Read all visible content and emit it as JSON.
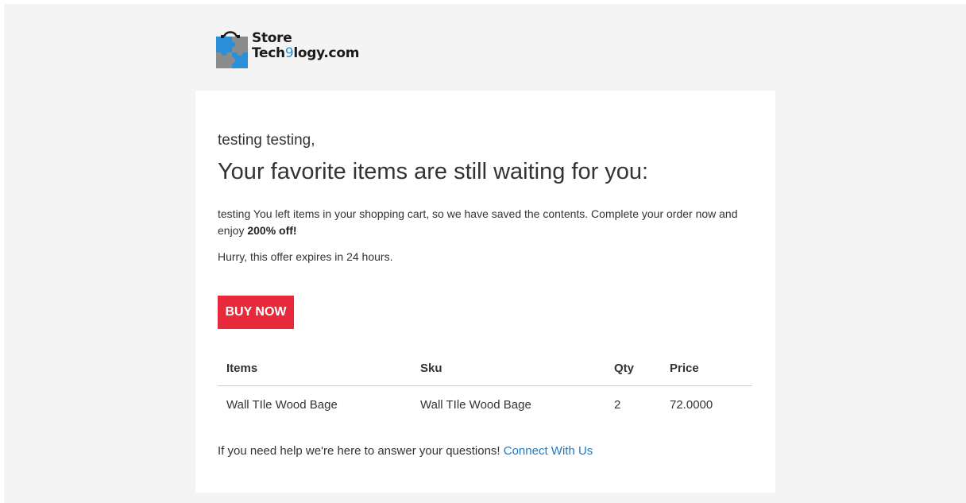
{
  "brand": {
    "line1": "Store",
    "line2_pre": "Tech",
    "line2_digit": "9",
    "line2_post": "logy.com",
    "colors": {
      "blue": "#2a8fd8",
      "gray": "#8c8c8c",
      "dark": "#1a1a1a"
    }
  },
  "email": {
    "greeting": "testing testing,",
    "headline": "Your favorite items are still waiting for you:",
    "body_prefix": "testing You left items in your shopping cart, so we have saved the contents. Complete your order now and enjoy ",
    "body_bold": "200% off!",
    "hurry": "Hurry, this offer expires in 24 hours.",
    "buy_label": "BUY NOW",
    "buy_color": "#e8293b"
  },
  "table": {
    "headers": [
      "Items",
      "Sku",
      "Qty",
      "Price"
    ],
    "rows": [
      [
        "Wall TIle Wood Bage",
        "Wall TIle Wood Bage",
        "2",
        "72.0000"
      ]
    ]
  },
  "footer": {
    "help_text": "If you need help we're here to answer your questions!",
    "link_label": "Connect With Us",
    "link_color": "#1f79c2"
  }
}
